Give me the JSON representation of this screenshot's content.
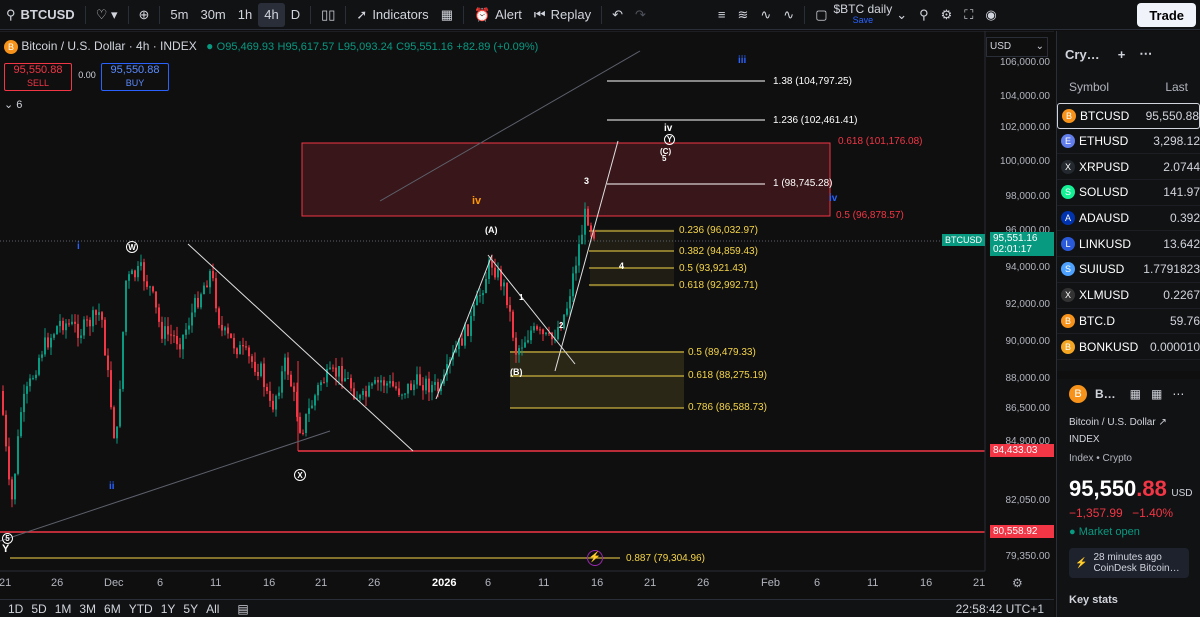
{
  "toolbar": {
    "symbol": "BTCUSD",
    "intervals": [
      "5m",
      "30m",
      "1h",
      "4h",
      "D"
    ],
    "selected_interval": "4h",
    "indicators": "Indicators",
    "alert": "Alert",
    "replay": "Replay",
    "layout_name": "$BTC daily",
    "layout_status": "Save",
    "trade": "Trade"
  },
  "legend": {
    "title": "Bitcoin / U.S. Dollar · 4h · INDEX",
    "open": "O95,469.93",
    "high": "H95,617.57",
    "low": "L95,093.24",
    "close": "C95,551.16",
    "change": "+82.89 (+0.09%)",
    "sell_price": "95,550.88",
    "sell_label": "SELL",
    "spread": "0.00",
    "buy_price": "95,550.88",
    "buy_label": "BUY",
    "indicator_count": "6"
  },
  "price_axis": {
    "currency": "USD",
    "labels": [
      "106,000.00",
      "104,000.00",
      "102,000.00",
      "100,000.00",
      "98,000.00",
      "96,000.00",
      "94,000.00",
      "92,000.00",
      "90,000.00",
      "88,000.00",
      "86,500.00",
      "84,900.00",
      "82,050.00",
      "79,350.00"
    ],
    "current_symbol": "BTCUSD",
    "current_price": "95,551.16",
    "countdown": "02:01:17",
    "level_1": "84,433.03",
    "level_2": "80,558.92"
  },
  "time_axis": [
    "21",
    "26",
    "Dec",
    "6",
    "11",
    "16",
    "21",
    "26",
    "2026",
    "6",
    "11",
    "16",
    "21",
    "26",
    "Feb",
    "6",
    "11",
    "16",
    "21"
  ],
  "fib_levels": [
    {
      "label": "1.38 (104,797.25)",
      "color": "#ffffff"
    },
    {
      "label": "1.236 (102,461.41)",
      "color": "#ffffff"
    },
    {
      "label": "0.618 (101,176.08)",
      "color": "#f23645"
    },
    {
      "label": "1 (98,745.28)",
      "color": "#ffffff"
    },
    {
      "label": "0.5 (96,878.57)",
      "color": "#f23645"
    },
    {
      "label": "0.236 (96,032.97)",
      "color": "#f5d547"
    },
    {
      "label": "0.382 (94,859.43)",
      "color": "#f5d547"
    },
    {
      "label": "0.5 (93,921.43)",
      "color": "#f5d547"
    },
    {
      "label": "0.618 (92,992.71)",
      "color": "#f5d547"
    },
    {
      "label": "0.5 (89,479.33)",
      "color": "#f5d547"
    },
    {
      "label": "0.618 (88,275.19)",
      "color": "#f5d547"
    },
    {
      "label": "0.786 (86,588.73)",
      "color": "#f5d547"
    },
    {
      "label": "0.887 (79,304.96)",
      "color": "#f5d547"
    }
  ],
  "wave_labels": {
    "iii": "iii",
    "iv_top": "iv",
    "y": "Y",
    "c": "(C)",
    "five": "5",
    "three": "3",
    "iv_orange": "iv",
    "iv_blue": "iv",
    "a": "(A)",
    "one": "1",
    "two": "2",
    "four": "4",
    "b": "(B)",
    "i": "i",
    "w": "W",
    "x": "X",
    "ii": "ii",
    "five_low": "5",
    "y_low": "Y"
  },
  "bottom": {
    "ranges": [
      "1D",
      "5D",
      "1M",
      "3M",
      "6M",
      "YTD",
      "1Y",
      "5Y",
      "All"
    ],
    "clock": "22:58:42 UTC+1"
  },
  "watchlist": {
    "title": "Cry…",
    "col_symbol": "Symbol",
    "col_last": "Last",
    "rows": [
      {
        "symbol": "BTCUSD",
        "last": "95,550.88",
        "color": "#f7931a",
        "icon": "B"
      },
      {
        "symbol": "ETHUSD",
        "last": "3,298.12",
        "color": "#627eea",
        "icon": "E"
      },
      {
        "symbol": "XRPUSD",
        "last": "2.0744",
        "color": "#23292f",
        "icon": "X"
      },
      {
        "symbol": "SOLUSD",
        "last": "141.97",
        "color": "#14f195",
        "icon": "S"
      },
      {
        "symbol": "ADAUSD",
        "last": "0.392",
        "color": "#0033ad",
        "icon": "A"
      },
      {
        "symbol": "LINKUSD",
        "last": "13.642",
        "color": "#2a5ada",
        "icon": "L"
      },
      {
        "symbol": "SUIUSD",
        "last": "1.7791823",
        "color": "#4da2ff",
        "icon": "S"
      },
      {
        "symbol": "XLMUSD",
        "last": "0.2267",
        "color": "#333333",
        "icon": "X"
      },
      {
        "symbol": "BTC.D",
        "last": "59.76",
        "color": "#f7931a",
        "icon": "B"
      },
      {
        "symbol": "BONKUSD",
        "last": "0.000010",
        "color": "#f5a623",
        "icon": "B"
      }
    ]
  },
  "details": {
    "short": "B…",
    "name": "Bitcoin / U.S. Dollar",
    "exchange": "INDEX",
    "type": "Index • Crypto",
    "price_main": "95,550",
    "price_frac": ".88",
    "currency": "USD",
    "change": "−1,357.99",
    "change_pct": "−1.40%",
    "market": "Market open",
    "news_time": "28 minutes ago",
    "news_title": "CoinDesk Bitcoin…",
    "key_stats": "Key stats"
  },
  "colors": {
    "up": "#089981",
    "down": "#f23645",
    "fib": "#f5d547",
    "blue": "#2962ff"
  }
}
